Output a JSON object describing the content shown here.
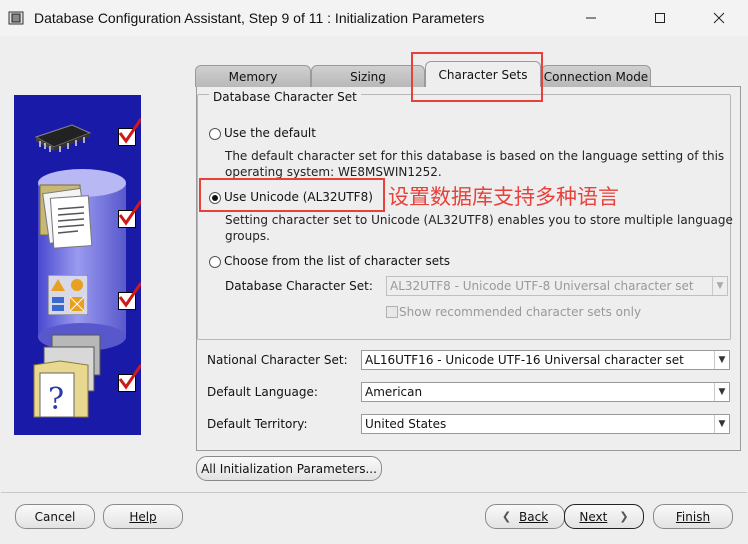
{
  "window": {
    "title": "Database Configuration Assistant, Step 9 of 11 : Initialization Parameters",
    "controls": [
      "minimize-icon",
      "maximize-icon",
      "close-icon"
    ]
  },
  "tabs": [
    {
      "label": "Memory",
      "active": false
    },
    {
      "label": "Sizing",
      "active": false
    },
    {
      "label": "Character Sets",
      "active": true
    },
    {
      "label": "Connection Mode",
      "active": false
    }
  ],
  "db_charset": {
    "group_title": "Database Character Set",
    "option_default": "Use the default",
    "default_desc_line1": "The default character set for this database is based on the language setting of this",
    "default_desc_line2": "operating system: WE8MSWIN1252.",
    "option_unicode": "Use Unicode (AL32UTF8)",
    "unicode_desc_line1": "Setting character set to Unicode (AL32UTF8) enables you to store multiple language",
    "unicode_desc_line2": "groups.",
    "option_choose": "Choose from the list of character sets",
    "list_label": "Database Character Set:",
    "list_value": "AL32UTF8 - Unicode UTF-8 Universal character set",
    "show_recommended": "Show recommended character sets only",
    "selected": "unicode"
  },
  "national_charset": {
    "label": "National Character Set:",
    "value": "AL16UTF16 - Unicode UTF-16 Universal character set"
  },
  "default_language": {
    "label": "Default Language:",
    "value": "American"
  },
  "default_territory": {
    "label": "Default Territory:",
    "value": "United States"
  },
  "all_params_button": "All Initialization Parameters...",
  "annotation": "设置数据库支持多种语言",
  "footer": {
    "cancel": "Cancel",
    "help": "Help",
    "back": "Back",
    "next": "Next",
    "finish": "Finish"
  },
  "colors": {
    "accent_red": "#e8413c",
    "panel_blue": "#1a1aa8"
  }
}
